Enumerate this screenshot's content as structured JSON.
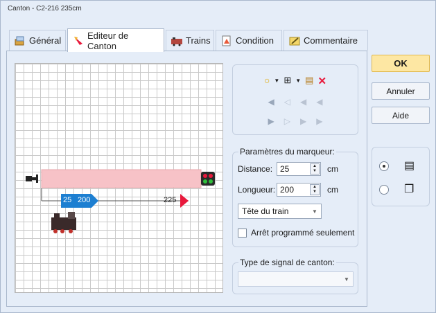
{
  "window": {
    "title": "Canton - C2-216 235cm"
  },
  "tabs": [
    {
      "label": "Général",
      "icon": "general-icon",
      "active": false
    },
    {
      "label": "Editeur de Canton",
      "icon": "editor-icon",
      "active": true
    },
    {
      "label": "Trains",
      "icon": "trains-icon",
      "active": false
    },
    {
      "label": "Condition",
      "icon": "condition-icon",
      "active": false
    },
    {
      "label": "Commentaire",
      "icon": "comment-icon",
      "active": false
    }
  ],
  "canvas": {
    "marker_blue_left": "25",
    "marker_blue_right": "200",
    "marker_red": "225",
    "colors": {
      "track": "#f7c2c7",
      "blue_marker": "#1d7fd1",
      "red_marker": "#e8193c"
    }
  },
  "toolbar": {
    "icons": [
      "circle-marker-icon",
      "dropdown-arrow-icon",
      "move-icon",
      "dropdown-arrow-icon",
      "properties-icon",
      "delete-icon"
    ],
    "nav_rows": 2
  },
  "marker_params": {
    "group_label": "Paramètres du marqueur:",
    "distance_label": "Distance:",
    "distance_value": "25",
    "distance_unit": "cm",
    "length_label": "Longueur:",
    "length_value": "200",
    "length_unit": "cm",
    "position_value": "Tête du train",
    "checkbox_label": "Arrêt programmé seulement"
  },
  "signal": {
    "group_label": "Type de signal de canton:",
    "value": ""
  },
  "buttons": {
    "ok": "OK",
    "cancel": "Annuler",
    "help": "Aide"
  },
  "view_options": {
    "selected": "list"
  }
}
